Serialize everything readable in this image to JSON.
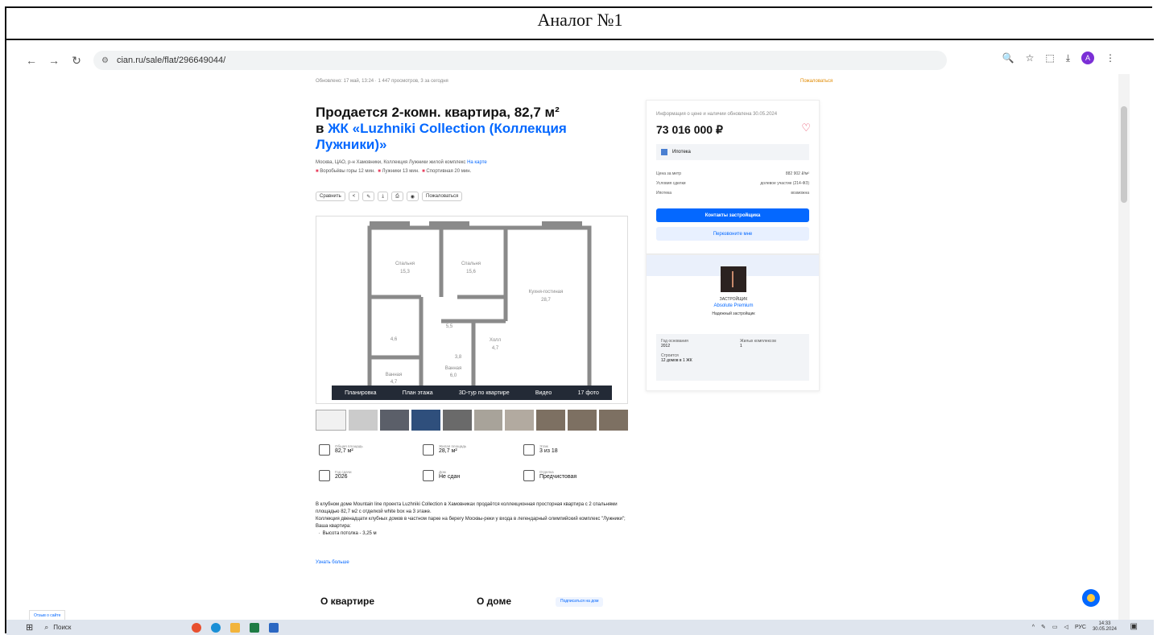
{
  "doc": {
    "title": "Аналог №1"
  },
  "browser": {
    "url": "cian.ru/sale/flat/296649044/",
    "icons": [
      "back-icon",
      "forward-icon",
      "reload-icon",
      "site-info-icon",
      "zoom-icon",
      "star-icon",
      "extensions-icon",
      "download-icon",
      "profile-icon",
      "menu-icon"
    ],
    "avatar": "A"
  },
  "listing": {
    "updated": "Обновлено: 17 май, 13:24",
    "views": "1 447 просмотров, 3 за сегодня",
    "complain": "Пожаловаться",
    "title_line1": "Продается 2-комн. квартира, 82,7 м²",
    "title_in": "в ",
    "title_link": "ЖК «Luzhniki Collection (Коллекция Лужники)»",
    "address": "Москва, ЦАО, р-н Хамовники, Коллекция Лужники жилой комплекс",
    "on_map": "На карте",
    "metro": [
      {
        "name": "Воробьёвы горы",
        "time": "12 мин."
      },
      {
        "name": "Лужники",
        "time": "13 мин."
      },
      {
        "name": "Спортивная",
        "time": "20 мин."
      }
    ],
    "actions": [
      "Сравнить",
      "",
      "",
      "",
      "",
      "",
      "Пожаловаться"
    ],
    "plan_bar": [
      "Планировка",
      "План этажа",
      "3D-тур по квартире",
      "Видео",
      "17 фото"
    ],
    "plan_labels": {
      "spalnya1": "Спальня",
      "spalnya1_area": "15,3",
      "spalnya2": "Спальня",
      "spalnya2_area": "15,6",
      "kitchen": "Кухня-гостиная",
      "kitchen_area": "28,7",
      "hall": "5,5",
      "toilet1": "4,6",
      "toilet2": "3,8",
      "holl": "Холл",
      "holl_area": "4,7",
      "vannaya": "Ванная",
      "vannaya_area": "6,0",
      "vannaya2": "Ванная",
      "vannaya2_area": "4,7"
    },
    "features": [
      {
        "label": "Общая площадь",
        "value": "82,7 м²"
      },
      {
        "label": "Жилая площадь",
        "value": "28,7 м²"
      },
      {
        "label": "Этаж",
        "value": "3 из 18"
      },
      {
        "label": "Год сдачи",
        "value": "2026"
      },
      {
        "label": "Дом",
        "value": "Не сдан"
      },
      {
        "label": "Отделка",
        "value": "Предчистовая"
      }
    ],
    "description": "В клубном доме Mountain line проекта Luzhniki Collection в Хамовниках продаётся коллекционная просторная квартира с 2 спальнями площадью 82,7 м2 с отделкой white box на 3 этаже.",
    "description2": "Коллекция двенадцати клубных домов в частном парке на берегу Москвы-реки у входа в легендарный олимпийский комплекс \"Лужники\";",
    "description3": "Ваша квартира:",
    "description4": "Высота потолка - 3,25 м",
    "more": "Узнать больше",
    "section_apartment": "О квартире",
    "section_house": "О доме",
    "section_btn": "Подписаться на дом"
  },
  "sidebar": {
    "info": "Информация о цене и наличии обновлена 30.05.2024",
    "price": "73 016 000 ₽",
    "mortgage": "Ипотека",
    "rows": [
      {
        "k": "Цена за метр",
        "v": "882 902 ₽/м²"
      },
      {
        "k": "Условия сделки",
        "v": "долевое участие (214-ФЗ)"
      },
      {
        "k": "Ипотека",
        "v": "возможна"
      }
    ],
    "contacts_btn": "Контакты застройщика",
    "callback_btn": "Перезвоните мне",
    "dev_caption": "ЗАСТРОЙЩИК",
    "dev_name": "Absolute Premium",
    "dev_badge": "Надежный застройщик",
    "dev_stats": [
      {
        "k": "Год основания",
        "v": "2012"
      },
      {
        "k": "Жилых комплексов",
        "v": "1"
      },
      {
        "k": "Строится",
        "v": "12 домов в 1 ЖК"
      }
    ]
  },
  "page": {
    "feedback": "Отзыв о сайте"
  },
  "taskbar": {
    "search": "Поиск",
    "lang": "РУС",
    "time": "14:33",
    "date": "30.05.2024"
  },
  "colors": {
    "accent": "#0468ff",
    "heart": "#e84260",
    "plan_wall": "#8a8a8a"
  }
}
